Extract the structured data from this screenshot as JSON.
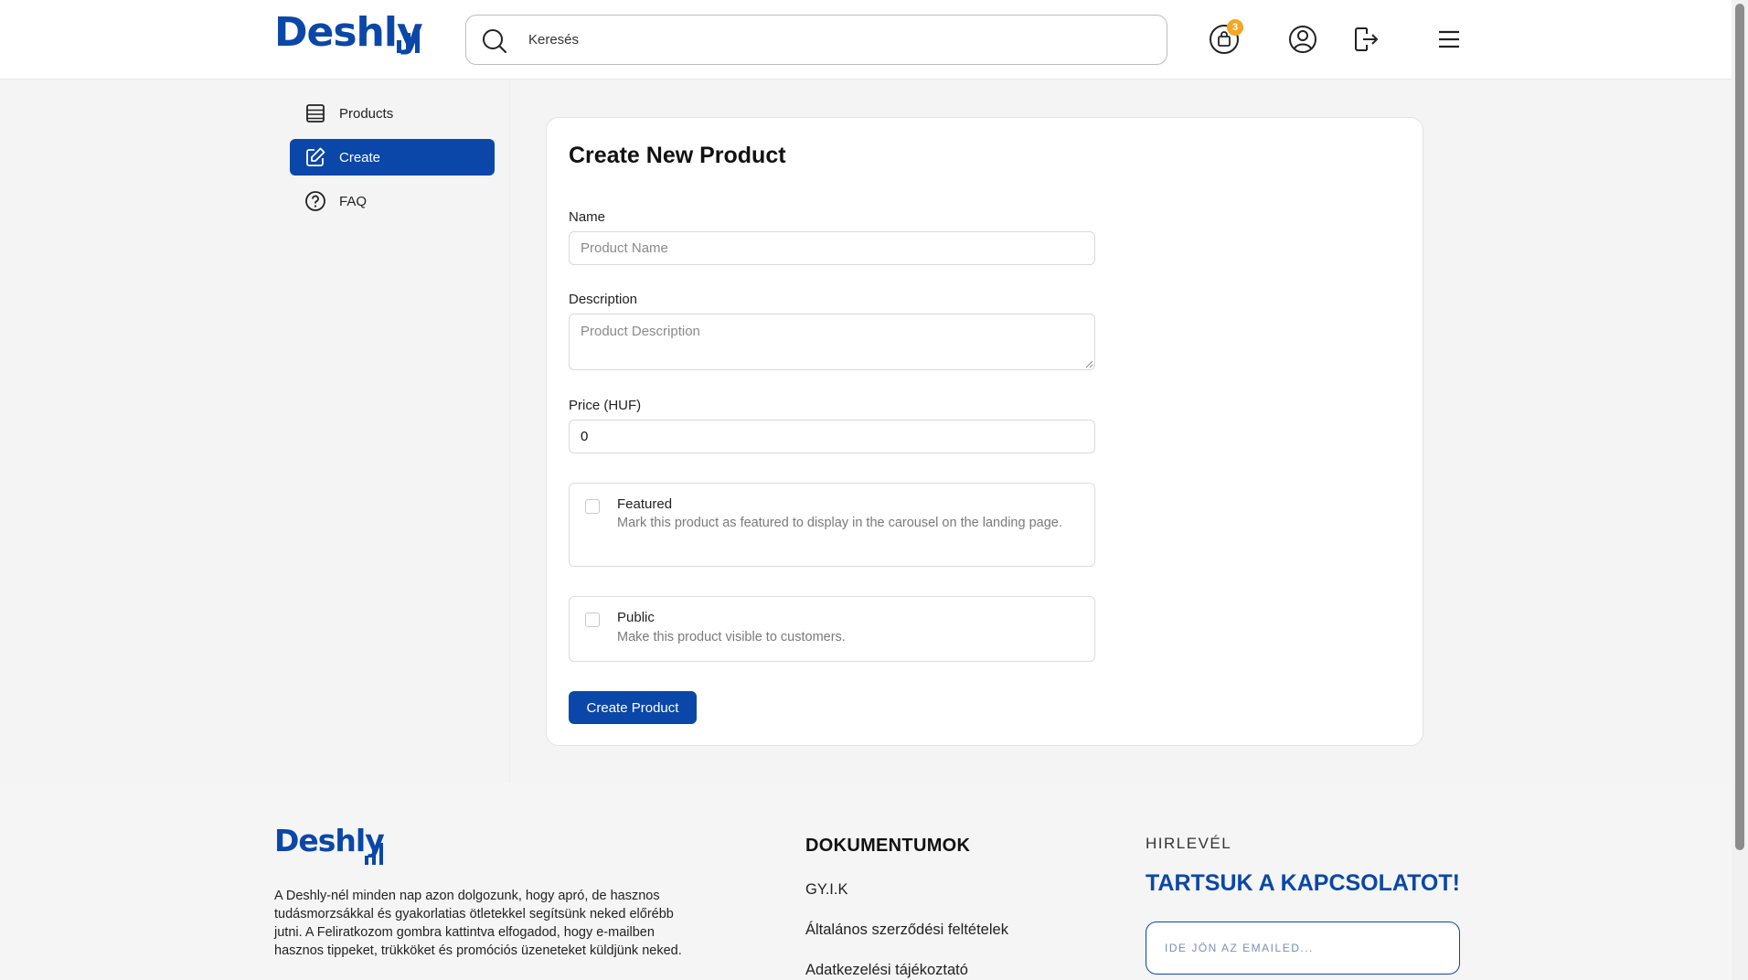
{
  "header": {
    "logo": "Deshly",
    "search_placeholder": "Keresés",
    "cart_count": "3"
  },
  "sidebar": {
    "items": [
      {
        "label": "Products",
        "icon": "list-icon"
      },
      {
        "label": "Create",
        "icon": "edit-icon",
        "active": true
      },
      {
        "label": "FAQ",
        "icon": "help-icon"
      }
    ]
  },
  "form": {
    "title": "Create New Product",
    "name_label": "Name",
    "name_placeholder": "Product Name",
    "description_label": "Description",
    "description_placeholder": "Product Description",
    "price_label": "Price (HUF)",
    "price_value": "0",
    "featured_title": "Featured",
    "featured_desc": "Mark this product as featured to display in the carousel on the landing page.",
    "public_title": "Public",
    "public_desc": "Make this product visible to customers.",
    "submit_label": "Create Product"
  },
  "footer": {
    "logo": "Deshly",
    "about": "A Deshly-nél minden nap azon dolgozunk, hogy apró, de hasznos tudásmorzsákkal és gyakorlatias ötletekkel segítsünk neked előrébb jutni. A Feliratkozom gombra kattintva elfogadod, hogy e-mailben hasznos tippeket, trükköket és promóciós üzeneteket küldjünk neked.",
    "docs_heading": "DOKUMENTUMOK",
    "docs_links": [
      "GY.I.K",
      "Általános szerződési feltételek",
      "Adatkezelési tájékoztató"
    ],
    "newsletter_label": "HIRLEVÉL",
    "newsletter_heading": "TARTSUK A KAPCSOLATOT!",
    "email_placeholder": "IDE JÖN AZ EMAILED..."
  },
  "colors": {
    "brand": "#0b47a8",
    "badge": "#f5a623"
  }
}
